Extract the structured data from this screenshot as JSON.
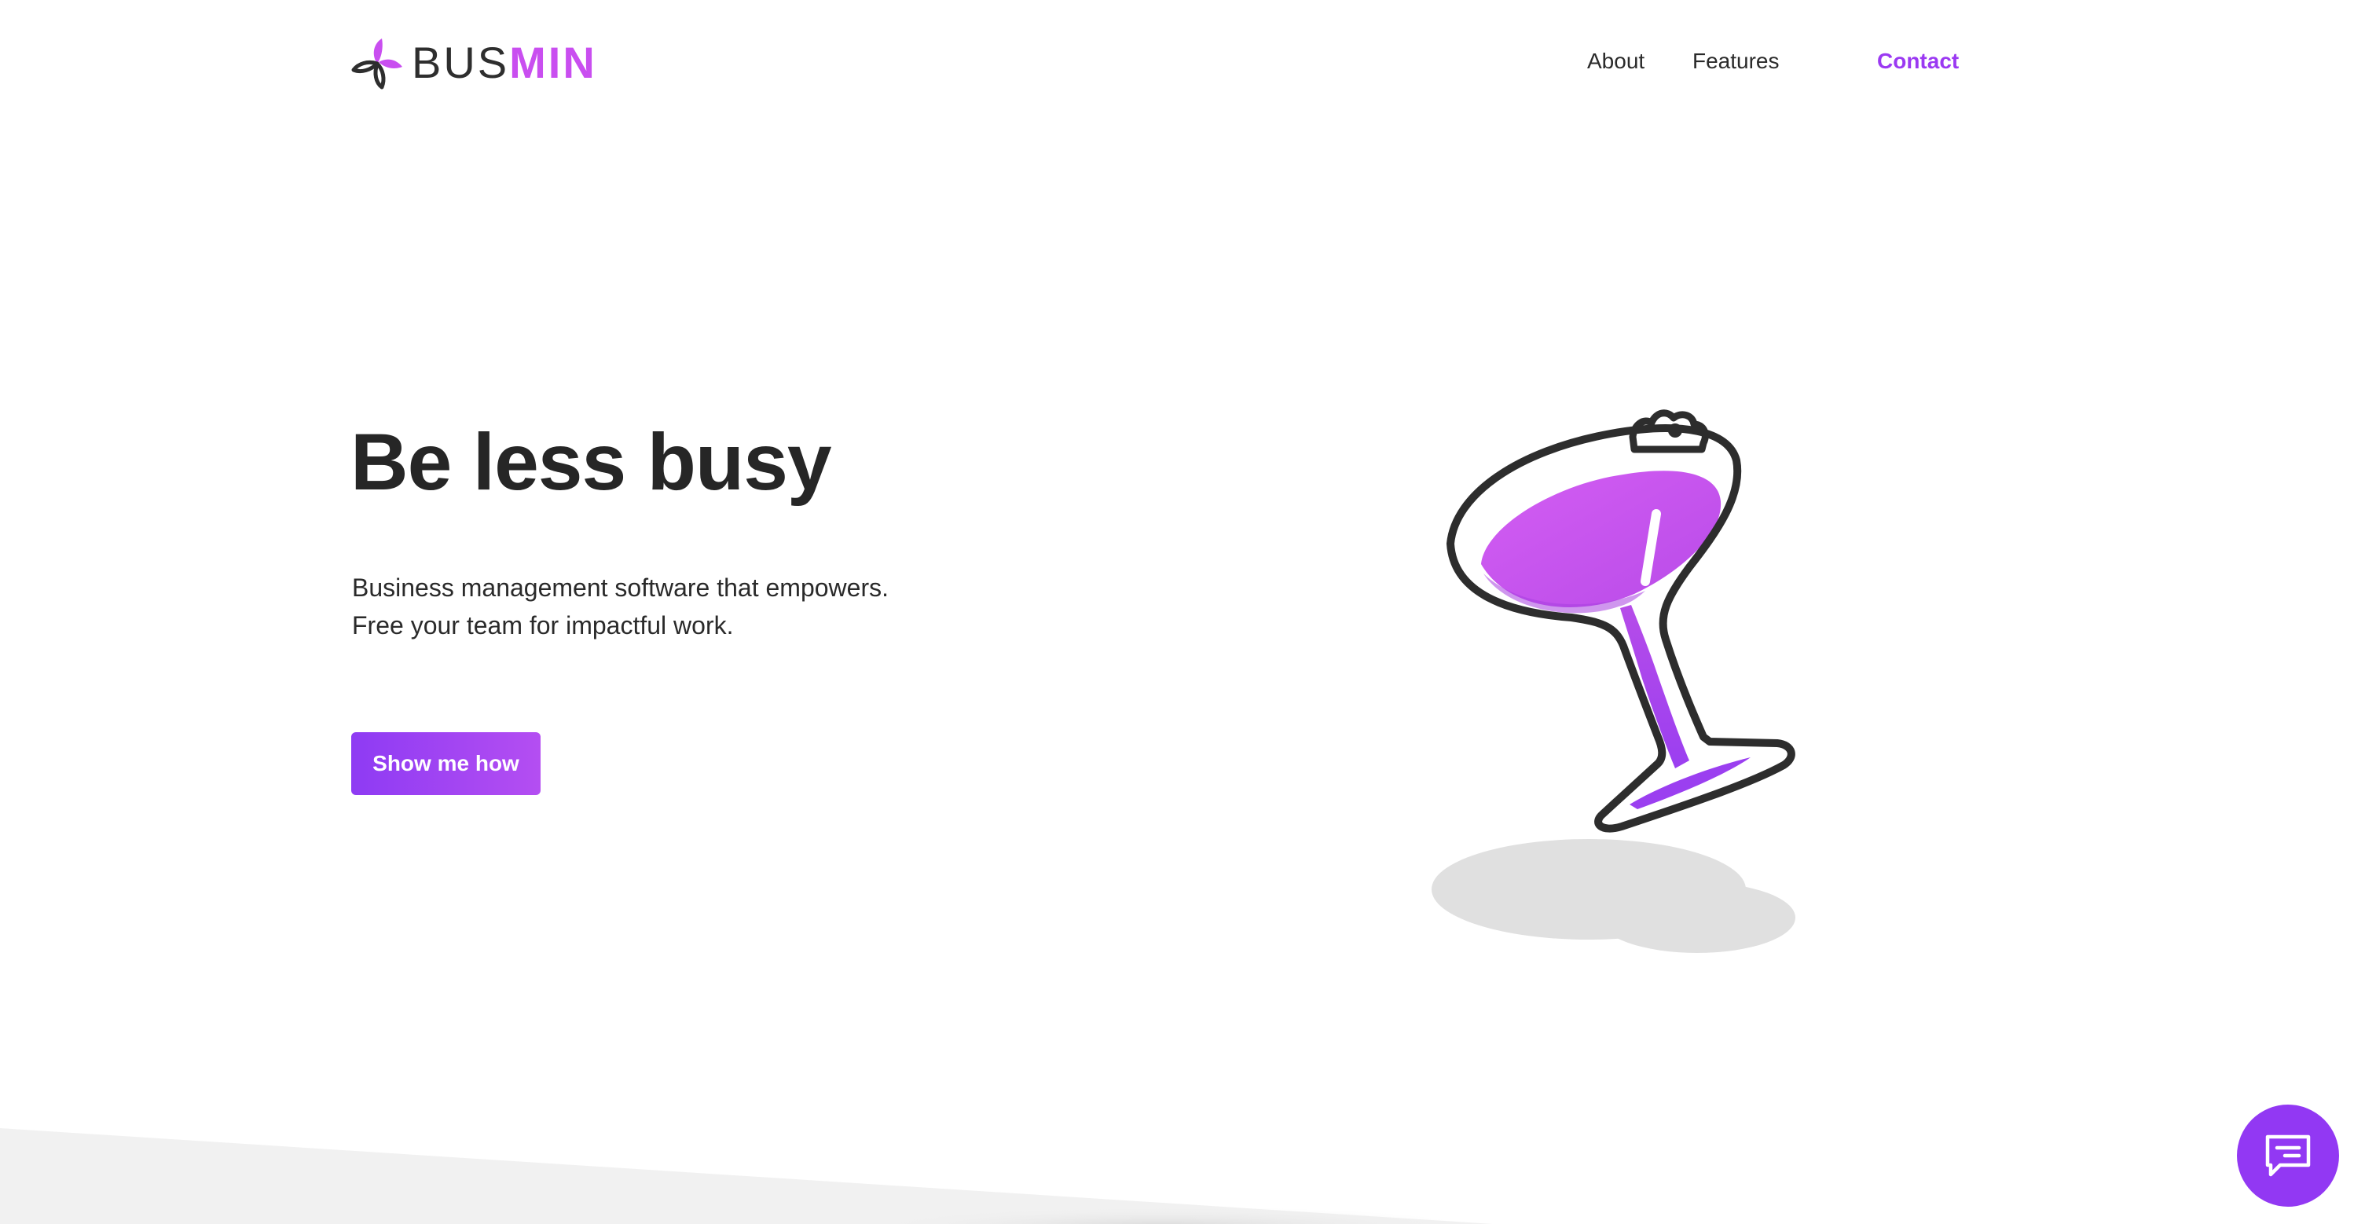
{
  "brand": {
    "name_part1": "BUS",
    "name_part2": "MIN",
    "logo_icon": "leaf-propeller-icon",
    "primary_color": "#9b39f2",
    "accent_color": "#c94ef0",
    "text_color": "#262626"
  },
  "nav": {
    "items": [
      {
        "label": "About"
      },
      {
        "label": "Features"
      },
      {
        "label": "Contact"
      }
    ],
    "active_index": 2
  },
  "hero": {
    "title": "Be less busy",
    "subtitle": "Business management software that empowers. Free your team for impactful work.",
    "cta_label": "Show me how"
  },
  "illustration": {
    "icon": "tipping-cocktail-glass-icon",
    "fill_color": "#c94ef0",
    "shadow_color": "#e0e0e0"
  },
  "chat_widget": {
    "icon": "chat-bubble-icon",
    "color": "#9238f3"
  }
}
